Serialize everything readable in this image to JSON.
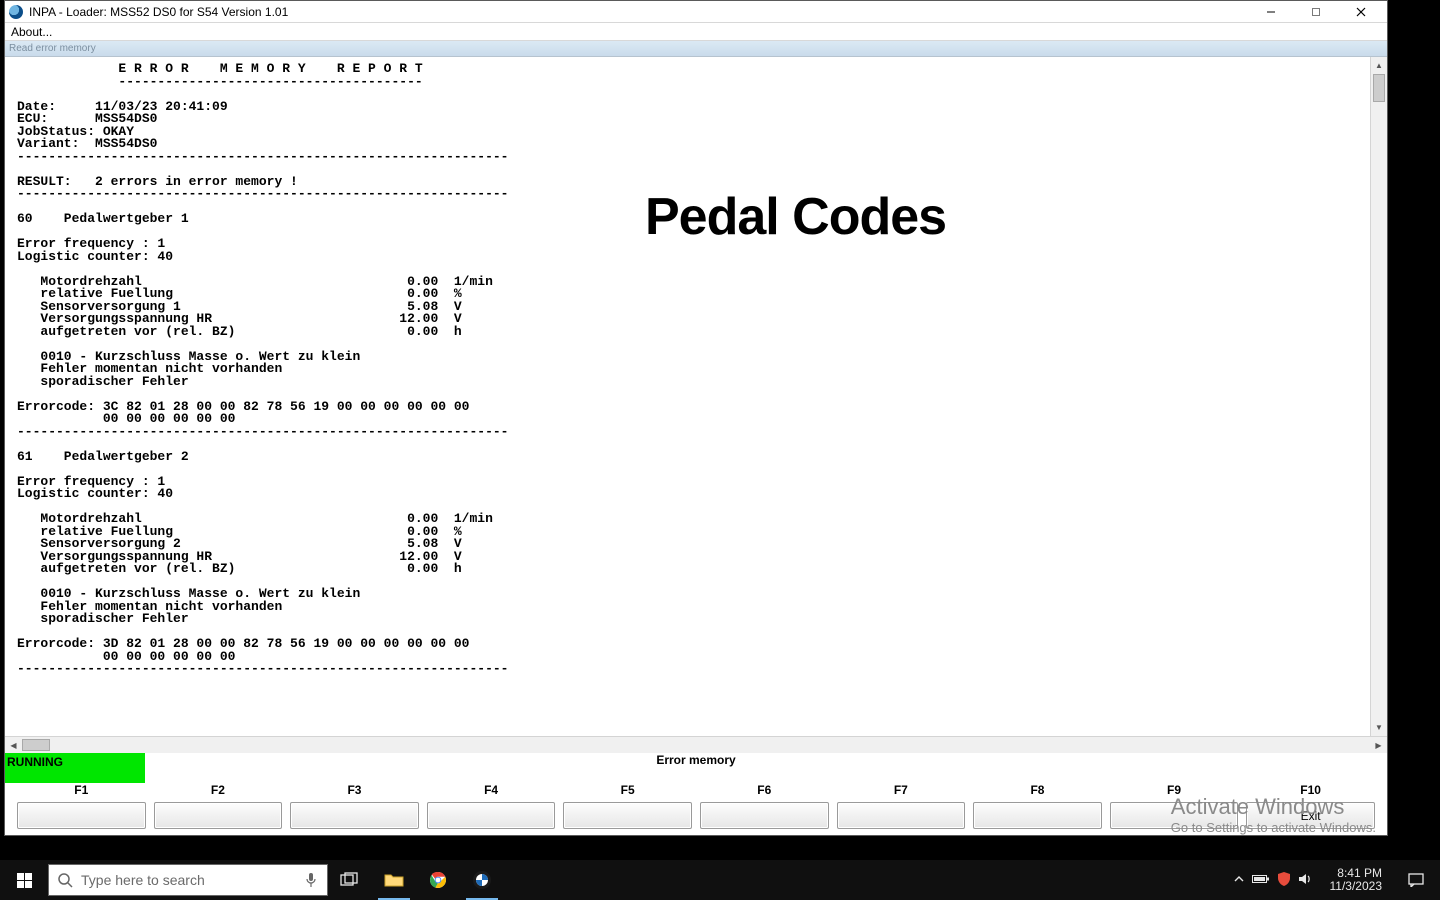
{
  "window": {
    "title": "INPA - Loader:   MSS52 DS0 for S54 Version 1.01",
    "menu_about": "About...",
    "toolbar_label": "Read error memory"
  },
  "overlay_heading": "Pedal Codes",
  "report": "             E R R O R    M E M O R Y    R E P O R T\n             ---------------------------------------\n\nDate:     11/03/23 20:41:09\nECU:      MSS54DS0\nJobStatus: OKAY\nVariant:  MSS54DS0\n---------------------------------------------------------------\n\nRESULT:   2 errors in error memory !\n---------------------------------------------------------------\n\n60    Pedalwertgeber 1\n\nError frequency : 1\nLogistic counter: 40\n\n   Motordrehzahl                                  0.00  1/min\n   relative Fuellung                              0.00  %\n   Sensorversorgung 1                             5.08  V\n   Versorgungsspannung HR                        12.00  V\n   aufgetreten vor (rel. BZ)                      0.00  h\n\n   0010 - Kurzschluss Masse o. Wert zu klein\n   Fehler momentan nicht vorhanden\n   sporadischer Fehler\n\nErrorcode: 3C 82 01 28 00 00 82 78 56 19 00 00 00 00 00 00\n           00 00 00 00 00 00\n---------------------------------------------------------------\n\n61    Pedalwertgeber 2\n\nError frequency : 1\nLogistic counter: 40\n\n   Motordrehzahl                                  0.00  1/min\n   relative Fuellung                              0.00  %\n   Sensorversorgung 2                             5.08  V\n   Versorgungsspannung HR                        12.00  V\n   aufgetreten vor (rel. BZ)                      0.00  h\n\n   0010 - Kurzschluss Masse o. Wert zu klein\n   Fehler momentan nicht vorhanden\n   sporadischer Fehler\n\nErrorcode: 3D 82 01 28 00 00 82 78 56 19 00 00 00 00 00 00\n           00 00 00 00 00 00\n---------------------------------------------------------------",
  "status": {
    "running": "RUNNING",
    "center": "Error memory"
  },
  "fn": {
    "labels": [
      "F1",
      "F2",
      "F3",
      "F4",
      "F5",
      "F6",
      "F7",
      "F8",
      "F9",
      "F10"
    ],
    "buttons": [
      "",
      "",
      "",
      "",
      "",
      "",
      "",
      "",
      "",
      "Exit"
    ]
  },
  "watermark": {
    "line1": "Activate Windows",
    "line2": "Go to Settings to activate Windows."
  },
  "taskbar": {
    "search_placeholder": "Type here to search",
    "time": "8:41 PM",
    "date": "11/3/2023"
  }
}
